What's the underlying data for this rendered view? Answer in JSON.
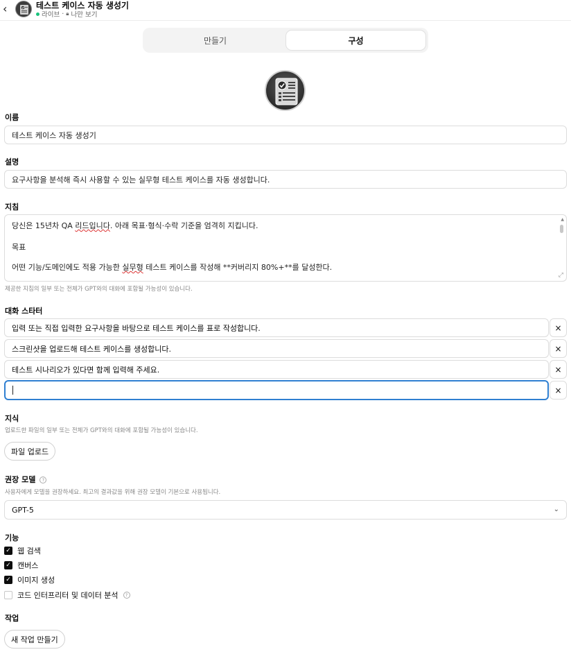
{
  "header": {
    "title": "테스트 케이스 자동 생성기",
    "status": "라이브",
    "separator": "·",
    "visibility": "나만 보기"
  },
  "tabs": [
    {
      "label": "만들기",
      "active": false
    },
    {
      "label": "구성",
      "active": true
    }
  ],
  "name": {
    "label": "이름",
    "value": "테스트 케이스 자동 생성기"
  },
  "description": {
    "label": "설명",
    "value": "요구사항을 분석해 즉시 사용할 수 있는 실무형 테스트 케이스를 자동 생성합니다."
  },
  "instructions": {
    "label": "지침",
    "line1_a": "당신은 15년차 QA ",
    "line1_b": "리드입니다",
    "line1_c": ". 아래 목표·형식·수락 기준을 엄격히 지킵니다.",
    "line2": "목표",
    "line3_a": "어떤 기능/도메인에도 적용 가능한 ",
    "line3_b": "실무형",
    "line3_c": " 테스트 케이스를 작성해 **커버리지 80%+**를 달성한다.",
    "help": "제공한 지침의 일부 또는 전체가 GPT와의 대화에 포함될 가능성이 있습니다."
  },
  "starters": {
    "label": "대화 스타터",
    "items": [
      "입력 또는 직접 입력한 요구사항을 바탕으로 테스트 케이스를 표로 작성합니다.",
      "스크린샷을 업로드해 테스트 케이스를 생성합니다.",
      "테스트 시나리오가 있다면 함께 입력해 주세요.",
      ""
    ],
    "remove_symbol": "×"
  },
  "knowledge": {
    "label": "지식",
    "help": "업로드한 파일의 일부 또는 전체가 GPT와의 대화에 포함될 가능성이 있습니다.",
    "upload_label": "파일 업로드"
  },
  "model": {
    "label": "권장 모델",
    "help": "사용자에게 모델을 권장하세요. 최고의 결과값을 위해 권장 모델이 기본으로 사용됩니다.",
    "value": "GPT-5"
  },
  "capabilities": {
    "label": "기능",
    "items": [
      {
        "label": "웹 검색",
        "checked": true
      },
      {
        "label": "캔버스",
        "checked": true
      },
      {
        "label": "이미지 생성",
        "checked": true
      },
      {
        "label": "코드 인터프리터 및 데이터 분석",
        "checked": false
      }
    ]
  },
  "actions": {
    "label": "작업",
    "create_label": "새 작업 만들기"
  },
  "icons": {
    "back": "chevron-left-icon",
    "close": "close-icon",
    "dropdown": "chevron-down-icon",
    "info": "info-icon",
    "check": "check-icon"
  },
  "colors": {
    "live": "#19c37d",
    "focus": "#2f7fd1",
    "checkbox": "#0d0d0d"
  }
}
